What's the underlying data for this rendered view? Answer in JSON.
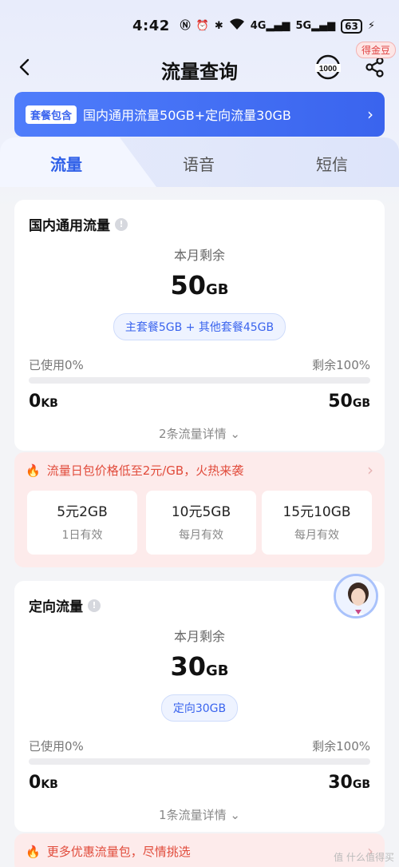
{
  "status": {
    "time": "4:42",
    "icons": [
      "nfc-icon",
      "alarm-icon",
      "bluetooth-icon",
      "wifi-icon",
      "signal-4g-icon",
      "signal-5g-icon"
    ],
    "battery": "63"
  },
  "nav": {
    "title": "流量查询",
    "badge": "得金豆"
  },
  "banner": {
    "tag": "套餐包含",
    "text": "国内通用流量50GB+定向流量30GB"
  },
  "tabs": [
    {
      "label": "流量",
      "active": true
    },
    {
      "label": "语音",
      "active": false
    },
    {
      "label": "短信",
      "active": false
    }
  ],
  "general": {
    "title": "国内通用流量",
    "remain_label": "本月剩余",
    "remain_value": "50",
    "remain_unit": "GB",
    "breakdown": "主套餐5GB + 其他套餐45GB",
    "used_label": "已使用0%",
    "left_label": "剩余100%",
    "used_fraction": 0,
    "used_value": "0",
    "used_unit": "KB",
    "total_value": "50",
    "total_unit": "GB",
    "details": "2条流量详情"
  },
  "promo": {
    "text": "流量日包价格低至2元/GB，火热来袭",
    "offers": [
      {
        "name": "5元2GB",
        "sub": "1日有效"
      },
      {
        "name": "10元5GB",
        "sub": "每月有效"
      },
      {
        "name": "15元10GB",
        "sub": "每月有效"
      }
    ]
  },
  "directed": {
    "title": "定向流量",
    "remain_label": "本月剩余",
    "remain_value": "30",
    "remain_unit": "GB",
    "breakdown": "定向30GB",
    "used_label": "已使用0%",
    "left_label": "剩余100%",
    "used_fraction": 0,
    "used_value": "0",
    "used_unit": "KB",
    "total_value": "30",
    "total_unit": "GB",
    "details": "1条流量详情"
  },
  "promo2": {
    "text": "更多优惠流量包，尽情挑选"
  },
  "watermark": "值 什么值得买"
}
